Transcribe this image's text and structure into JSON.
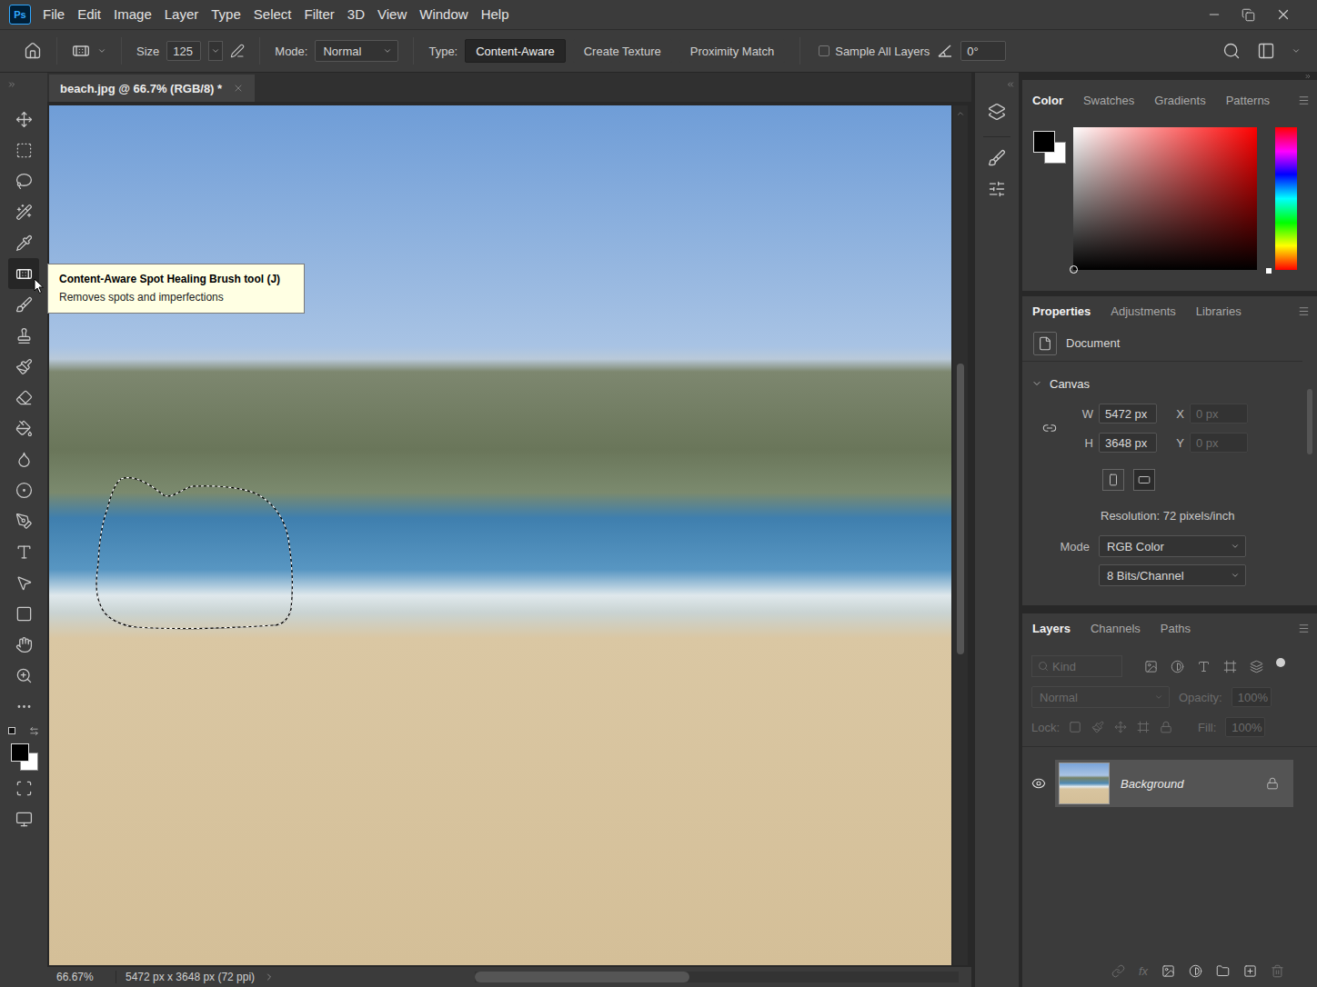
{
  "app": {
    "logo": "Ps"
  },
  "menu": [
    "File",
    "Edit",
    "Image",
    "Layer",
    "Type",
    "Select",
    "Filter",
    "3D",
    "View",
    "Window",
    "Help"
  ],
  "options_bar": {
    "size_label": "Size",
    "size_value": "125",
    "mode_label": "Mode:",
    "mode_value": "Normal",
    "type_label": "Type:",
    "types": [
      {
        "label": "Content-Aware",
        "selected": true
      },
      {
        "label": "Create Texture",
        "selected": false
      },
      {
        "label": "Proximity Match",
        "selected": false
      }
    ],
    "sample_all_layers": {
      "label": "Sample All Layers",
      "checked": false
    },
    "angle": "0°"
  },
  "toolbar": {
    "tools": [
      {
        "selected": false
      },
      {
        "selected": false
      },
      {
        "selected": false
      },
      {
        "selected": false
      },
      {
        "selected": false
      },
      {
        "selected": true
      },
      {
        "selected": false
      },
      {
        "selected": false
      },
      {
        "selected": false
      },
      {
        "selected": false
      },
      {
        "selected": false
      },
      {
        "selected": false
      },
      {
        "selected": false
      },
      {
        "selected": false
      },
      {
        "selected": false
      },
      {
        "selected": false
      },
      {
        "selected": false
      },
      {
        "selected": false
      },
      {
        "selected": false
      },
      {
        "selected": false
      }
    ]
  },
  "document": {
    "tab_title": "beach.jpg @ 66.7% (RGB/8) *",
    "selection_active": true
  },
  "tooltip": {
    "title": "Content-Aware Spot Healing Brush tool (J)",
    "description": "Removes spots and imperfections"
  },
  "status_bar": {
    "zoom": "66.67%",
    "info": "5472 px x 3648 px (72 ppi)"
  },
  "color_panel": {
    "tabs": [
      {
        "label": "Color",
        "selected": true
      },
      {
        "label": "Swatches",
        "selected": false
      },
      {
        "label": "Gradients",
        "selected": false
      },
      {
        "label": "Patterns",
        "selected": false
      }
    ]
  },
  "properties_panel": {
    "tabs": [
      {
        "label": "Properties",
        "selected": true
      },
      {
        "label": "Adjustments",
        "selected": false
      },
      {
        "label": "Libraries",
        "selected": false
      }
    ],
    "section": "Document",
    "canvas": {
      "title": "Canvas",
      "expanded": true,
      "width_label": "W",
      "width": "5472 px",
      "height_label": "H",
      "height": "3648 px",
      "x_label": "X",
      "x": "0 px",
      "y_label": "Y",
      "y": "0 px",
      "xy_disabled": true,
      "resolution": "Resolution: 72 pixels/inch",
      "mode_label": "Mode",
      "mode": "RGB Color",
      "depth": "8 Bits/Channel"
    }
  },
  "layers_panel": {
    "tabs": [
      {
        "label": "Layers",
        "selected": true
      },
      {
        "label": "Channels",
        "selected": false
      },
      {
        "label": "Paths",
        "selected": false
      }
    ],
    "filter_placeholder": "Kind",
    "blend_mode": "Normal",
    "opacity_label": "Opacity:",
    "opacity": "100%",
    "lock_label": "Lock:",
    "fill_label": "Fill:",
    "fill": "100%",
    "controls_disabled": true,
    "layers": [
      {
        "name": "Background",
        "visible": true,
        "locked": true,
        "selected": true
      }
    ],
    "footer_fx": "fx"
  }
}
